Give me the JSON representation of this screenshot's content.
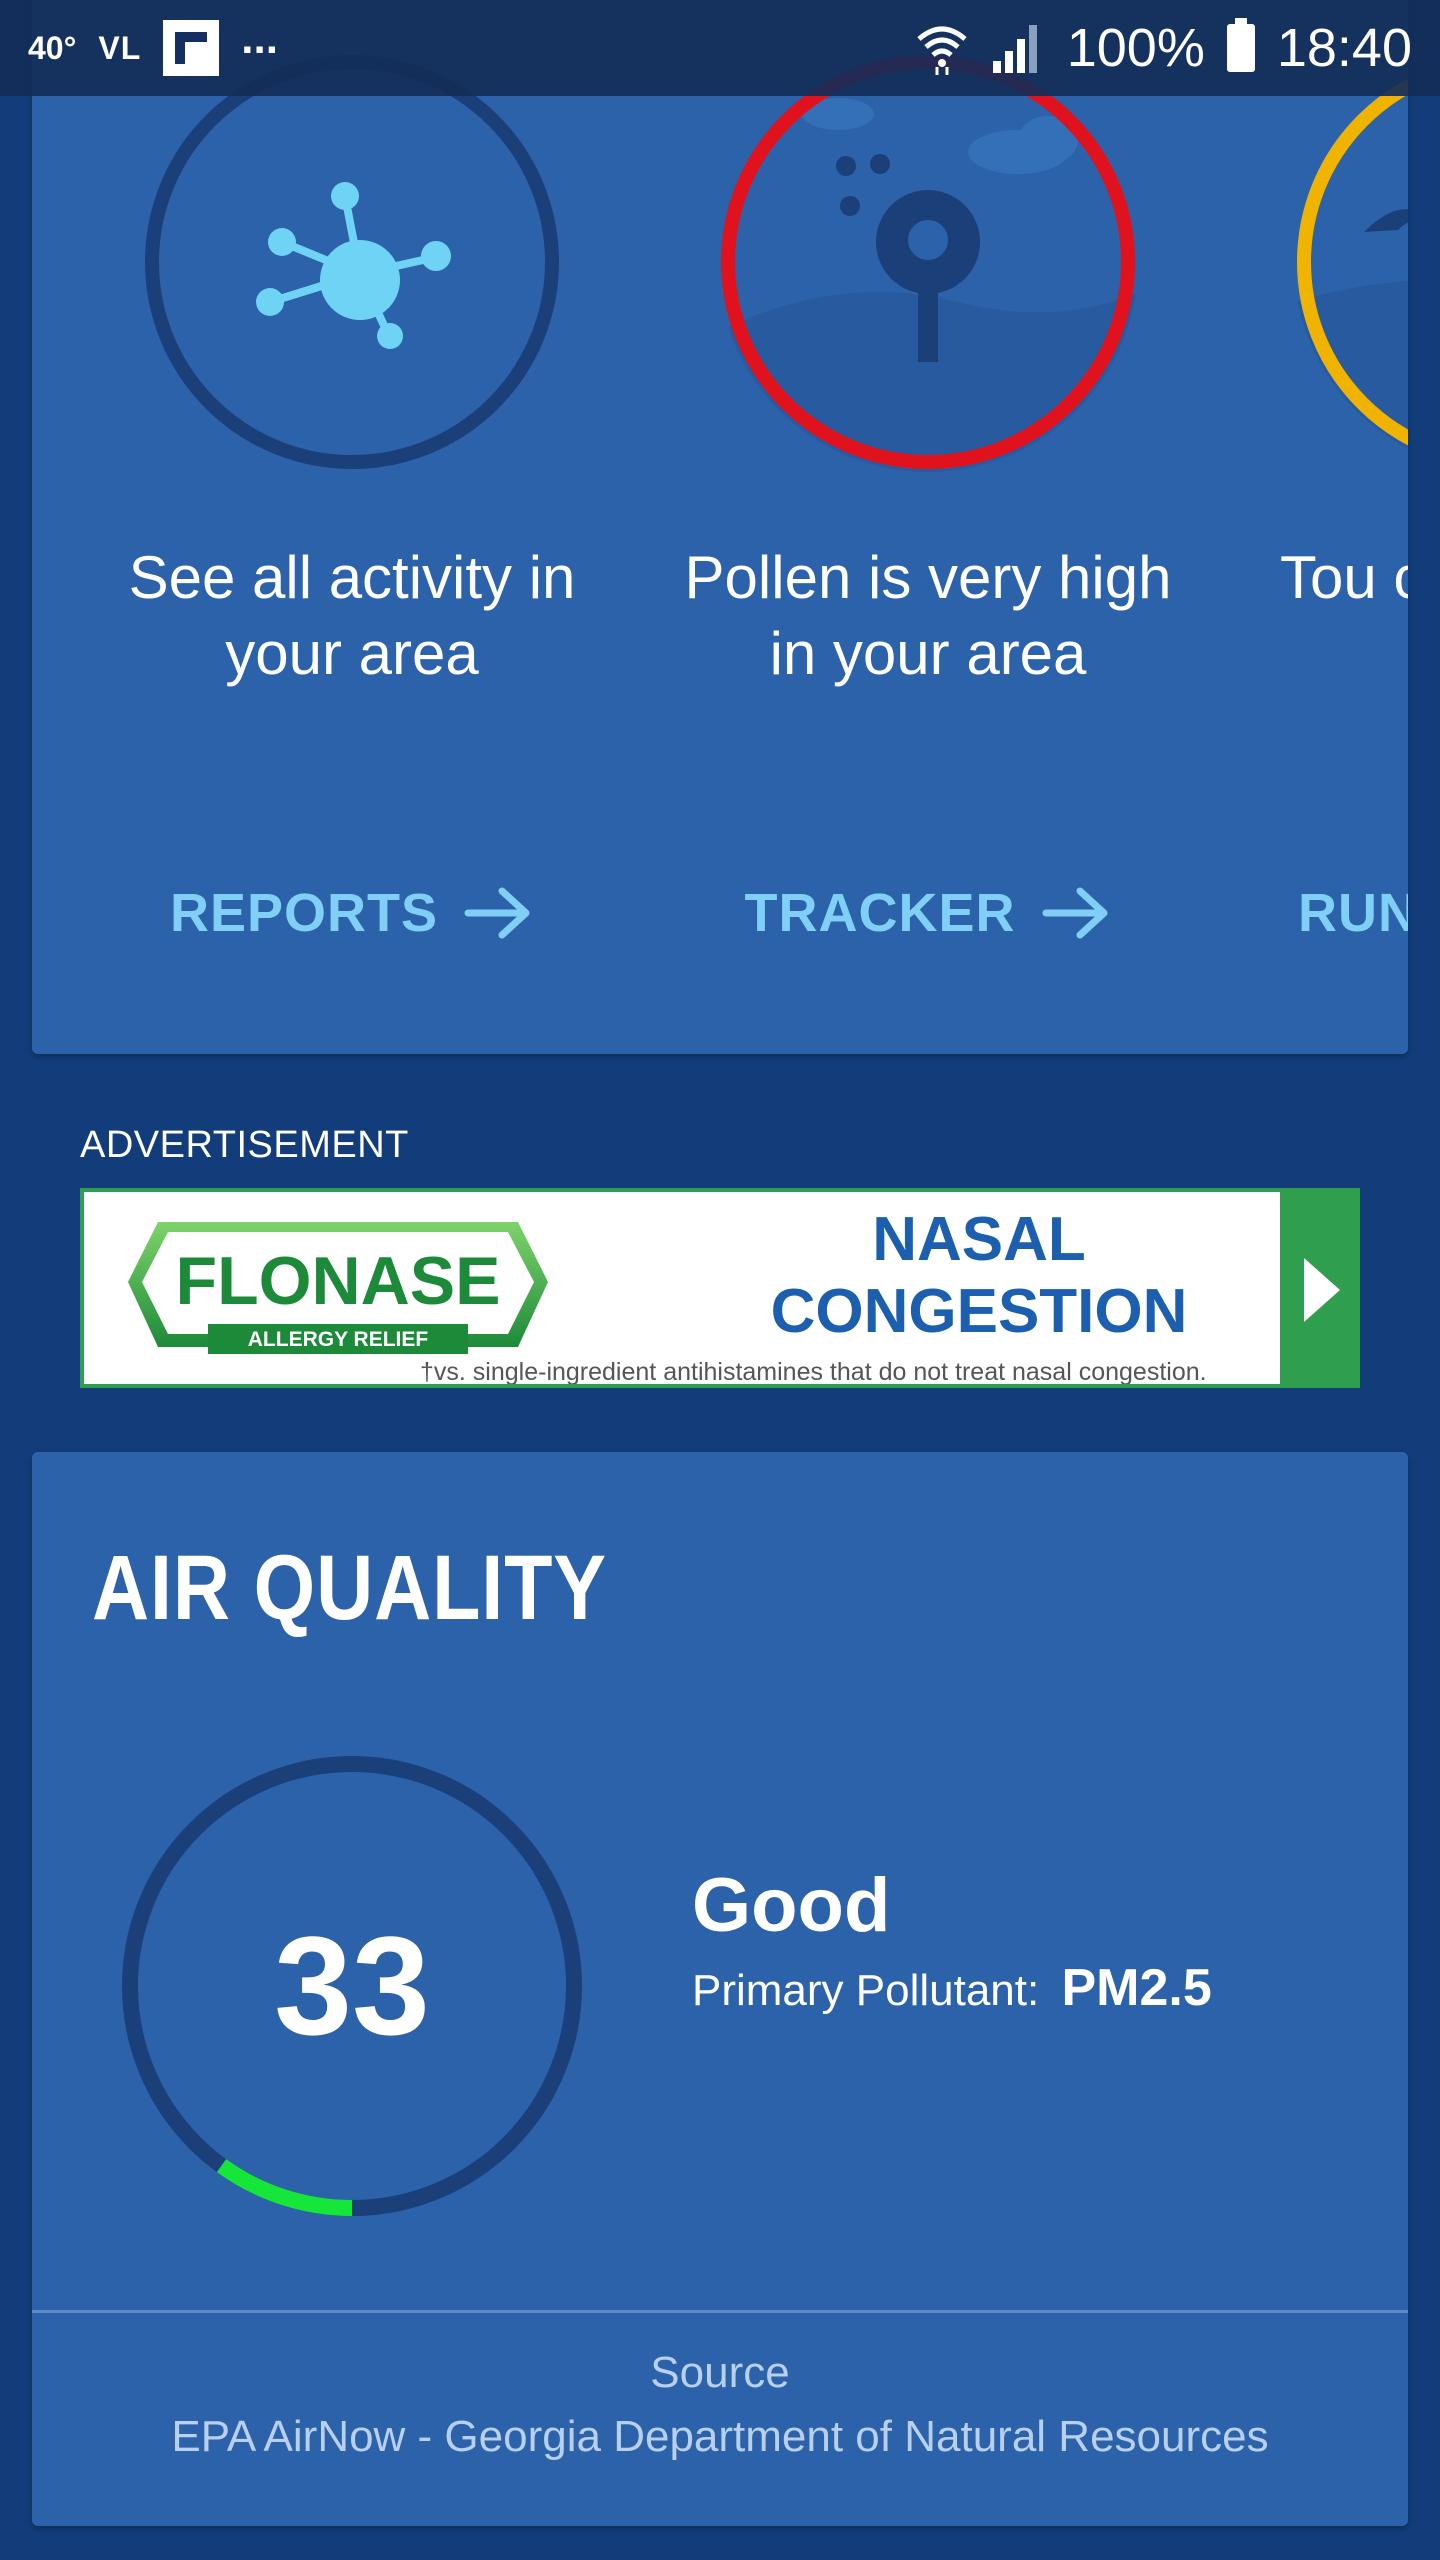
{
  "status_bar": {
    "temperature": "40°",
    "carrier": "VL",
    "more": "...",
    "battery_pct": "100%",
    "time": "18:40"
  },
  "carousel": {
    "items": [
      {
        "text": "See all activity in your area",
        "link_label": "REPORTS",
        "icon": "virus-activity-icon",
        "ring_color": "#1b3f78"
      },
      {
        "text": "Pollen is very high in your area",
        "link_label": "TRACKER",
        "icon": "pollen-tree-icon",
        "ring_color": "#e0121e"
      },
      {
        "text": "Tou condi",
        "link_label": "RUN T",
        "icon": "bird-landscape-icon",
        "ring_color": "#f0b400"
      }
    ]
  },
  "advertisement": {
    "label": "ADVERTISEMENT",
    "brand": "FLONASE",
    "brand_sub": "ALLERGY RELIEF",
    "headline_line1": "NASAL",
    "headline_line2": "CONGESTION",
    "disclaimer": "†vs. single-ingredient antihistamines that do not treat nasal congestion."
  },
  "air_quality": {
    "title": "AIR QUALITY",
    "aqi_value": "33",
    "aqi_fraction_of_scale": 0.1,
    "status": "Good",
    "pollutant_label": "Primary Pollutant:",
    "pollutant_value": "PM2.5",
    "source_label": "Source",
    "source_name": "EPA AirNow - Georgia Department of Natural Resources",
    "gauge_color": "#16e63a"
  },
  "colors": {
    "accent_link": "#7fcff6",
    "card_bg": "#2b62aa",
    "page_bg": "#123d7a"
  }
}
